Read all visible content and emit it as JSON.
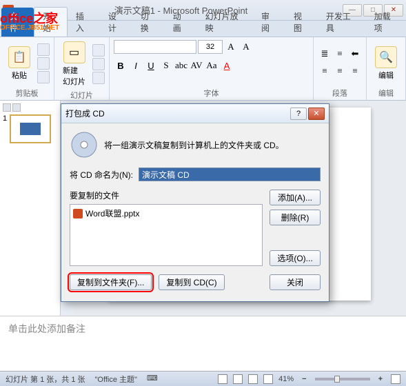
{
  "window": {
    "title": "演示文稿1 - Microsoft PowerPoint"
  },
  "logo": {
    "main": "office之家",
    "sub": "OFFICE.JB51.NET"
  },
  "tabs": {
    "file": "文件",
    "home": "开始",
    "insert": "插入",
    "design": "设计",
    "transition": "切换",
    "animation": "动画",
    "slideshow": "幻灯片放映",
    "review": "审阅",
    "view": "视图",
    "dev": "开发工具",
    "addins": "加载项"
  },
  "ribbon": {
    "clipboard": {
      "paste": "粘贴",
      "label": "剪贴板"
    },
    "slides": {
      "new": "新建\n幻灯片",
      "label": "幻灯片"
    },
    "font": {
      "size": "32",
      "label": "字体"
    },
    "paragraph": {
      "label": "段落"
    },
    "editing": {
      "find": "编辑",
      "label": "编辑"
    }
  },
  "workspace": {
    "thumb_num": "1"
  },
  "notes": "单击此处添加备注",
  "status": {
    "slide_info": "幻灯片 第 1 张，共 1 张",
    "theme": "\"Office 主题\"",
    "lang": "⌨",
    "zoom": "41%"
  },
  "dialog": {
    "title": "打包成 CD",
    "desc": "将一组演示文稿复制到计算机上的文件夹或 CD。",
    "name_label": "将 CD 命名为(N):",
    "name_value": "演示文稿 CD",
    "files_label": "要复制的文件",
    "file1": "Word联盟.pptx",
    "btn_add": "添加(A)...",
    "btn_remove": "删除(R)",
    "btn_options": "选项(O)...",
    "btn_folder": "复制到文件夹(F)...",
    "btn_cd": "复制到 CD(C)",
    "btn_close": "关闭"
  }
}
